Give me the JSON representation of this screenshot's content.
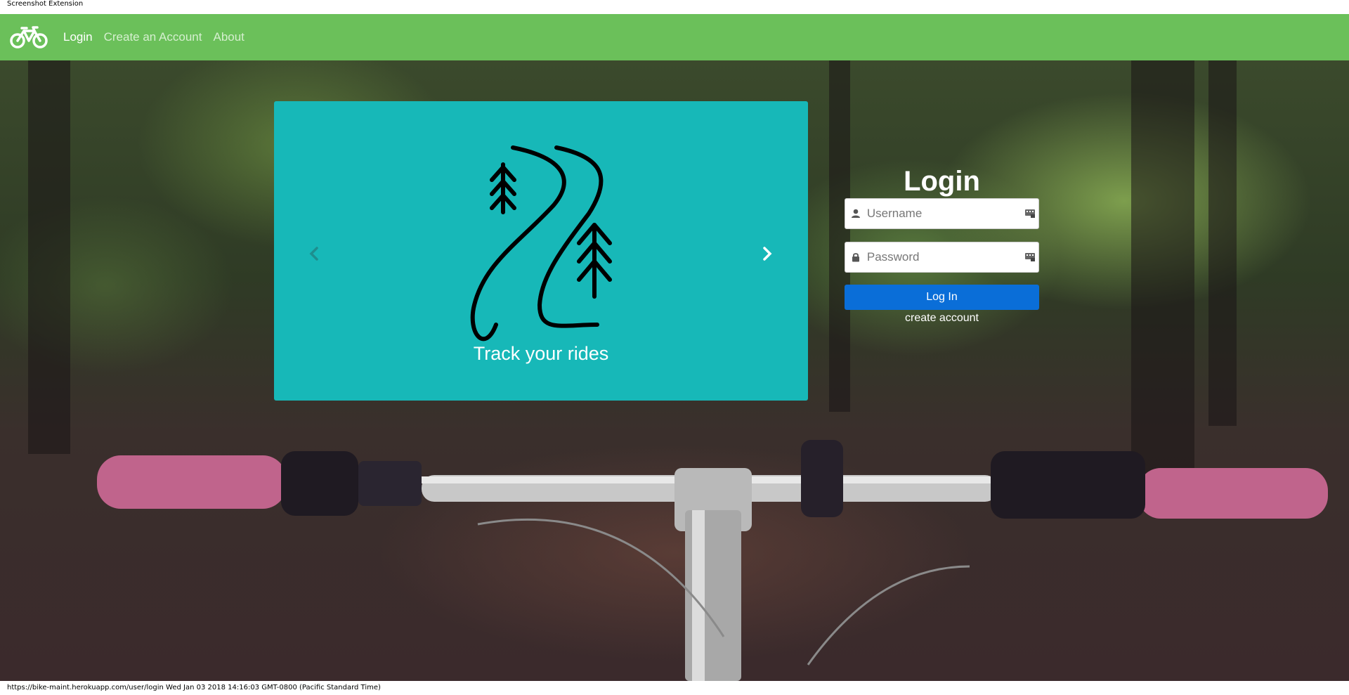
{
  "extension_bar": {
    "title": "Screenshot Extension"
  },
  "navbar": {
    "brand_icon": "bicycle-icon",
    "links": [
      {
        "label": "Login",
        "active": true
      },
      {
        "label": "Create an Account",
        "active": false
      },
      {
        "label": "About",
        "active": false
      }
    ],
    "color": "#6bc05a"
  },
  "carousel": {
    "caption": "Track your rides",
    "prev_icon": "chevron-left-icon",
    "next_icon": "chevron-right-icon",
    "illustration_icon": "trail-trees-icon",
    "background_color": "#17b8b8"
  },
  "login": {
    "title": "Login",
    "username_placeholder": "Username",
    "username_value": "",
    "password_placeholder": "Password",
    "password_value": "",
    "submit_label": "Log In",
    "create_link": "create account",
    "button_color": "#0a6ed8"
  },
  "status_bar": {
    "text": "https://bike-maint.herokuapp.com/user/login Wed Jan 03 2018 14:16:03 GMT-0800 (Pacific Standard Time)"
  }
}
